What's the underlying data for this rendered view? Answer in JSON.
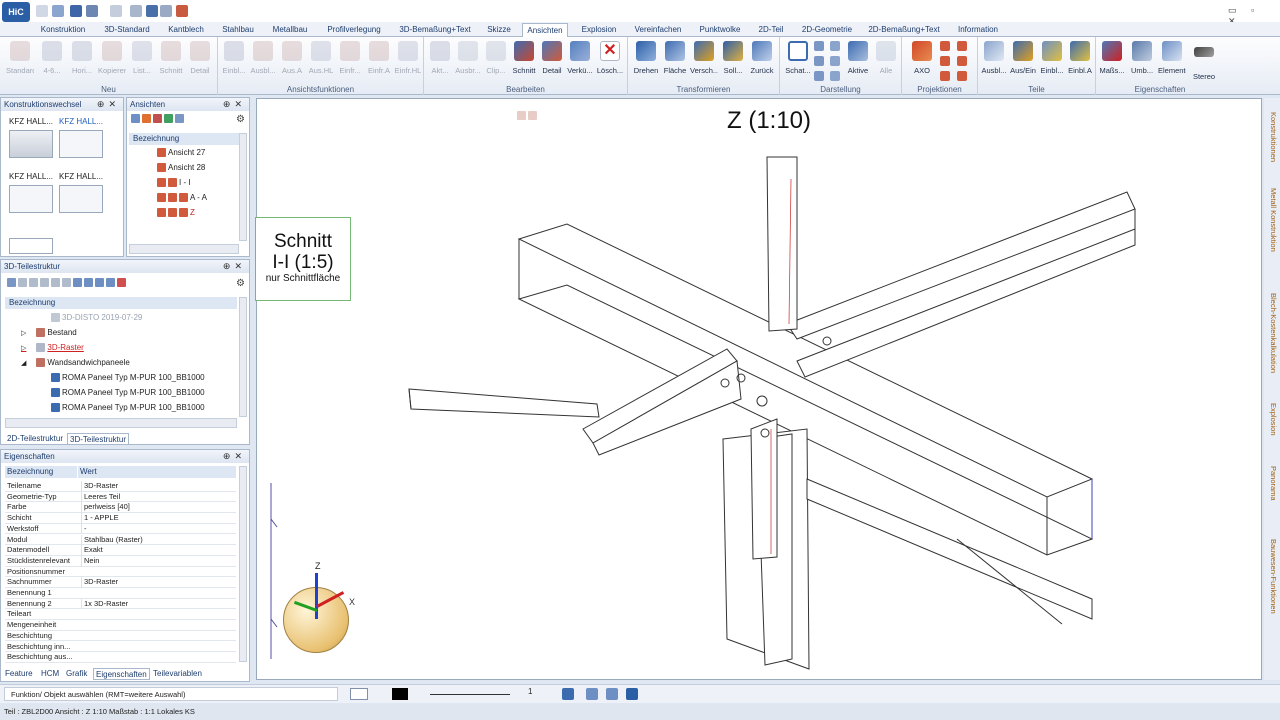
{
  "ribbon_tabs": [
    "Konstruktion",
    "3D-Standard",
    "Kantblech",
    "Stahlbau",
    "Metallbau",
    "Profilverlegung",
    "3D-Bemaßung+Text",
    "Skizze",
    "Ansichten",
    "Explosion",
    "Vereinfachen",
    "Punktwolke",
    "2D-Teil",
    "2D-Geometrie",
    "2D-Bemaßung+Text",
    "Information"
  ],
  "active_tab": "Ansichten",
  "ribbon_groups": {
    "neu": {
      "title": "Neu",
      "buttons": [
        "Standard",
        "4-6...",
        "Hori...",
        "Kopieren",
        "List...",
        "Schnitt",
        "Detail"
      ]
    },
    "ansicht": {
      "title": "Ansichtsfunktionen",
      "buttons": [
        "Einbl...",
        "Ausbl...",
        "Aus.A",
        "Aus.HL",
        "Einfr...",
        "Einfr.A",
        "Einfr.HL"
      ]
    },
    "bearbeiten": {
      "title": "Bearbeiten",
      "buttons": [
        "Akt...",
        "Ausbr...",
        "Clip...",
        "Schnitt",
        "Detail",
        "Verkü...",
        "Lösch..."
      ]
    },
    "transformieren": {
      "title": "Transformieren",
      "buttons": [
        "Drehen",
        "Fläche",
        "Versch...",
        "Soll...",
        "Zurück"
      ]
    },
    "darstellung": {
      "title": "Darstellung",
      "buttons": [
        "Schat...",
        "Aktive",
        "Alle"
      ]
    },
    "projektionen": {
      "title": "Projektionen",
      "buttons": [
        "AXO"
      ]
    },
    "teile": {
      "title": "Teile",
      "buttons": [
        "Ausbl...",
        "Aus/Ein",
        "Einbl...",
        "Einbl.A"
      ]
    },
    "eigenschaften": {
      "title": "Eigenschaften",
      "buttons": [
        "Maßs...",
        "Umb...",
        "Elemente",
        "Stereo"
      ]
    }
  },
  "panels": {
    "konstruktionswechsel": {
      "title": "Konstruktionswechsel",
      "items": [
        "KFZ HALL...",
        "KFZ HALL...",
        "KFZ HALL...",
        "KFZ HALL..."
      ]
    },
    "ansichten": {
      "title": "Ansichten",
      "col": "Bezeichnung",
      "items": [
        "Ansicht 27",
        "Ansicht 28",
        "I - I",
        "A - A",
        "Z"
      ]
    },
    "teilestruktur": {
      "title": "3D-Teilestruktur",
      "col": "Bezeichnung",
      "items": [
        "3D-DISTO 2019-07-29",
        "Bestand",
        "3D-Raster",
        "Wandsandwichpaneele",
        "ROMA Paneel Typ M-PUR 100_BB1000",
        "ROMA Paneel Typ M-PUR 100_BB1000",
        "ROMA Paneel Typ M-PUR 100_BB1000"
      ],
      "bottom_tabs": [
        "2D-Teilestruktur",
        "3D-Teilestruktur"
      ]
    },
    "eigenschaften": {
      "title": "Eigenschaften",
      "col_key": "Bezeichnung",
      "col_val": "Wert",
      "rows": [
        {
          "k": "Teilename",
          "v": "3D-Raster"
        },
        {
          "k": "Geometrie-Typ",
          "v": "Leeres Teil"
        },
        {
          "k": "Farbe",
          "v": "perlweiss [40]"
        },
        {
          "k": "Schicht",
          "v": "1 - APPLE"
        },
        {
          "k": "Werkstoff",
          "v": "-"
        },
        {
          "k": "Modul",
          "v": "Stahlbau (Raster)"
        },
        {
          "k": "Datenmodell",
          "v": "Exakt"
        },
        {
          "k": "Stücklistenrelevant",
          "v": "Nein"
        },
        {
          "k": "Positionsnummer",
          "v": ""
        },
        {
          "k": "Sachnummer",
          "v": "3D-Raster"
        },
        {
          "k": "Benennung 1",
          "v": ""
        },
        {
          "k": "Benennung 2",
          "v": "1x 3D-Raster"
        },
        {
          "k": "Teileart",
          "v": ""
        },
        {
          "k": "Mengeneinheit",
          "v": ""
        },
        {
          "k": "Beschichtung",
          "v": ""
        },
        {
          "k": "Beschichtung inn...",
          "v": ""
        },
        {
          "k": "Beschichtung aus...",
          "v": ""
        }
      ],
      "bottom_tabs": [
        "Feature",
        "HCM",
        "Grafik",
        "Eigenschaften",
        "Teilevariablen"
      ]
    }
  },
  "viewport": {
    "title": "Z (1:10)",
    "schnitt_label": {
      "line1": "Schnitt",
      "line2": "I-I (1:5)",
      "line3": "nur Schnittfläche"
    },
    "axes": {
      "z": "Z",
      "x": "X"
    }
  },
  "side_tabs": [
    "Konstruktionen",
    "Metall Konstruktion",
    "Blech-Kostenkalkulation",
    "Explosion",
    "Panorama",
    "Bauwesen-Funktionen"
  ],
  "command_bar": {
    "prompt": "Funktion/ Objekt auswählen (RMT=weitere Auswahl)",
    "line_width": "1"
  },
  "status_bar": "Teil : ZBL2D00   Ansicht : Z 1:10   Maßstab : 1:1   Lokales KS"
}
